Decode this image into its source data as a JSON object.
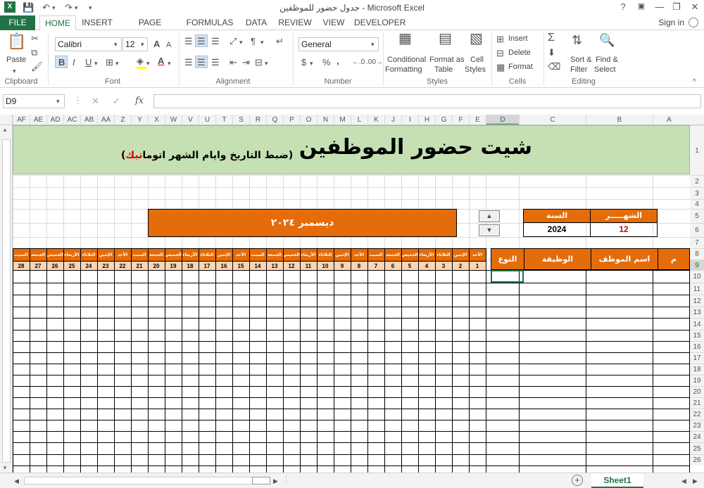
{
  "window": {
    "title": "جدول حضور للموظفين - Microsoft Excel",
    "help": "?",
    "minimize": "—",
    "restore": "❐",
    "close": "✕"
  },
  "menu": {
    "file": "FILE",
    "tabs": [
      "HOME",
      "INSERT",
      "PAGE LAYOUT",
      "FORMULAS",
      "DATA",
      "REVIEW",
      "VIEW",
      "DEVELOPER"
    ],
    "active_tab": "HOME",
    "sign_in": "Sign in"
  },
  "ribbon": {
    "clipboard": {
      "paste": "Paste",
      "label": "Clipboard"
    },
    "font": {
      "name": "Calibri",
      "size": "12",
      "bold": "B",
      "italic": "I",
      "underline": "U",
      "grow": "A",
      "shrink": "A",
      "label": "Font"
    },
    "alignment": {
      "label": "Alignment"
    },
    "number": {
      "format": "General",
      "label": "Number",
      "currency": "$",
      "percent": "%",
      "comma": ","
    },
    "styles": {
      "conditional_1": "Conditional",
      "conditional_2": "Formatting",
      "format_as_1": "Format as",
      "format_as_2": "Table",
      "cell_1": "Cell",
      "cell_2": "Styles",
      "label": "Styles"
    },
    "cells": {
      "insert": "Insert",
      "delete": "Delete",
      "format": "Format",
      "label": "Cells"
    },
    "editing": {
      "sort_1": "Sort &",
      "sort_2": "Filter",
      "find_1": "Find &",
      "find_2": "Select",
      "label": "Editing"
    }
  },
  "formula_bar": {
    "name_box": "D9",
    "fx": "fx",
    "cancel": "✕",
    "enter": "✓",
    "formula": ""
  },
  "columns": [
    {
      "label": "AF",
      "w": 24
    },
    {
      "label": "AE",
      "w": 24
    },
    {
      "label": "AD",
      "w": 24
    },
    {
      "label": "AC",
      "w": 24
    },
    {
      "label": "AB",
      "w": 24
    },
    {
      "label": "AA",
      "w": 24
    },
    {
      "label": "Z",
      "w": 24
    },
    {
      "label": "Y",
      "w": 24
    },
    {
      "label": "X",
      "w": 24
    },
    {
      "label": "W",
      "w": 24
    },
    {
      "label": "V",
      "w": 24
    },
    {
      "label": "U",
      "w": 24
    },
    {
      "label": "T",
      "w": 24
    },
    {
      "label": "S",
      "w": 24
    },
    {
      "label": "R",
      "w": 24
    },
    {
      "label": "Q",
      "w": 24
    },
    {
      "label": "P",
      "w": 24
    },
    {
      "label": "O",
      "w": 24
    },
    {
      "label": "N",
      "w": 24
    },
    {
      "label": "M",
      "w": 24
    },
    {
      "label": "L",
      "w": 24
    },
    {
      "label": "K",
      "w": 24
    },
    {
      "label": "J",
      "w": 24
    },
    {
      "label": "I",
      "w": 24
    },
    {
      "label": "H",
      "w": 24
    },
    {
      "label": "G",
      "w": 24
    },
    {
      "label": "F",
      "w": 24
    },
    {
      "label": "E",
      "w": 24
    },
    {
      "label": "D",
      "w": 47
    },
    {
      "label": "C",
      "w": 95
    },
    {
      "label": "B",
      "w": 95
    },
    {
      "label": "A",
      "w": 46
    }
  ],
  "rows": [
    "1",
    "2",
    "3",
    "4",
    "5",
    "6",
    "7",
    "8",
    "9",
    "10",
    "11",
    "12",
    "13",
    "14",
    "15",
    "16",
    "17",
    "18",
    "19",
    "20",
    "21",
    "22",
    "23",
    "24",
    "25",
    "26"
  ],
  "sheet": {
    "title": "شيت حضور الموظفين",
    "subtitle_before": "(ضبط التاريخ وايام الشهر اتوما",
    "subtitle_highlight": "تيك",
    "subtitle_after": ")",
    "month_year_banner": "ديسمبر ٢٠٢٤",
    "spin_up": "▲",
    "spin_down": "▼",
    "year_label": "السنة",
    "month_label": "الشهـــــر",
    "year_value": "2024",
    "month_value": "12",
    "headers": {
      "num": "م",
      "name": "اسم الموظف",
      "job": "الوظيفة",
      "type": "النوع"
    },
    "day_names": [
      "الأحد",
      "الإثنين",
      "الثلاثاء",
      "الأربعاء",
      "الخميس",
      "الجمعة",
      "السبت",
      "الأحد",
      "الإثنين",
      "الثلاثاء",
      "الأربعاء",
      "الخميس",
      "الجمعة",
      "السبت",
      "الأحد",
      "الإثنين",
      "الثلاثاء",
      "الأربعاء",
      "الخميس",
      "الجمعة",
      "السبت",
      "الأحد",
      "الإثنين",
      "الثلاثاء",
      "الأربعاء",
      "الخميس",
      "الجمعة",
      "السبت"
    ],
    "day_numbers": [
      "1",
      "2",
      "3",
      "4",
      "5",
      "6",
      "7",
      "8",
      "9",
      "10",
      "11",
      "12",
      "13",
      "14",
      "15",
      "16",
      "17",
      "18",
      "19",
      "20",
      "21",
      "22",
      "23",
      "24",
      "25",
      "26",
      "27",
      "28"
    ]
  },
  "sheet_tabs": {
    "active": "Sheet1",
    "add": "+"
  },
  "colors": {
    "excel_green": "#217346",
    "header_orange": "#e46c0a",
    "title_green": "#c6e0b4",
    "day_peach": "#fbd4b4"
  }
}
